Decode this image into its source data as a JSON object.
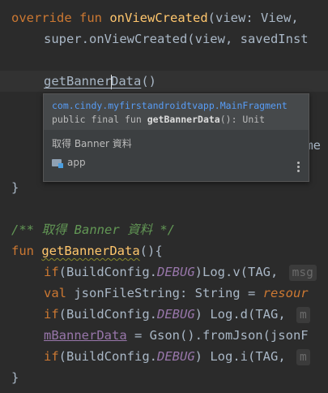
{
  "code": {
    "l1": {
      "kw1": "override",
      "kw2": "fun",
      "fn": "onViewCreated",
      "rest": "(view: View, "
    },
    "l2": {
      "text": "super.onViewCreated(view, savedInst"
    },
    "l4": {
      "before": "getBanner",
      "after": "Data",
      "tail": "()"
    },
    "l7_tail": "gme",
    "l8": {
      "text": "}"
    },
    "l10": {
      "text": "/** 取得 Banner 資料 */"
    },
    "l11": {
      "kw": "fun",
      "fn": "getBannerData",
      "rest": "(){"
    },
    "l12": {
      "kw": "if",
      "p1": "(BuildConfig.",
      "const": "DEBUG",
      "p2": ")Log.v(TAG, ",
      "hint": "msg"
    },
    "l13": {
      "kw": "val",
      "p1": " jsonFileString: String = ",
      "tail": "resour"
    },
    "l14": {
      "kw": "if",
      "p1": "(BuildConfig.",
      "const": "DEBUG",
      "p2": ") Log.d(TAG, ",
      "hint": "m"
    },
    "l15": {
      "field": "mBannerData",
      "p1": " = Gson().fromJson(jsonF"
    },
    "l16": {
      "kw": "if",
      "p1": "(BuildConfig.",
      "const": "DEBUG",
      "p2": ") Log.i(TAG, ",
      "hint": "m"
    },
    "l17": {
      "text": "}"
    }
  },
  "popup": {
    "class_path": "com.cindy.myfirstandroidtvapp.MainFragment",
    "sig_prefix": "public final fun ",
    "sig_name": "getBannerData",
    "sig_suffix": "(): Unit",
    "description": "取得 Banner 資料",
    "module": "app"
  },
  "colors": {
    "background": "#2b2b2b",
    "keyword": "#cc7832",
    "function": "#ffc66d",
    "text": "#a9b7c6",
    "constant": "#9876aa",
    "comment": "#629755",
    "link": "#589df6"
  }
}
